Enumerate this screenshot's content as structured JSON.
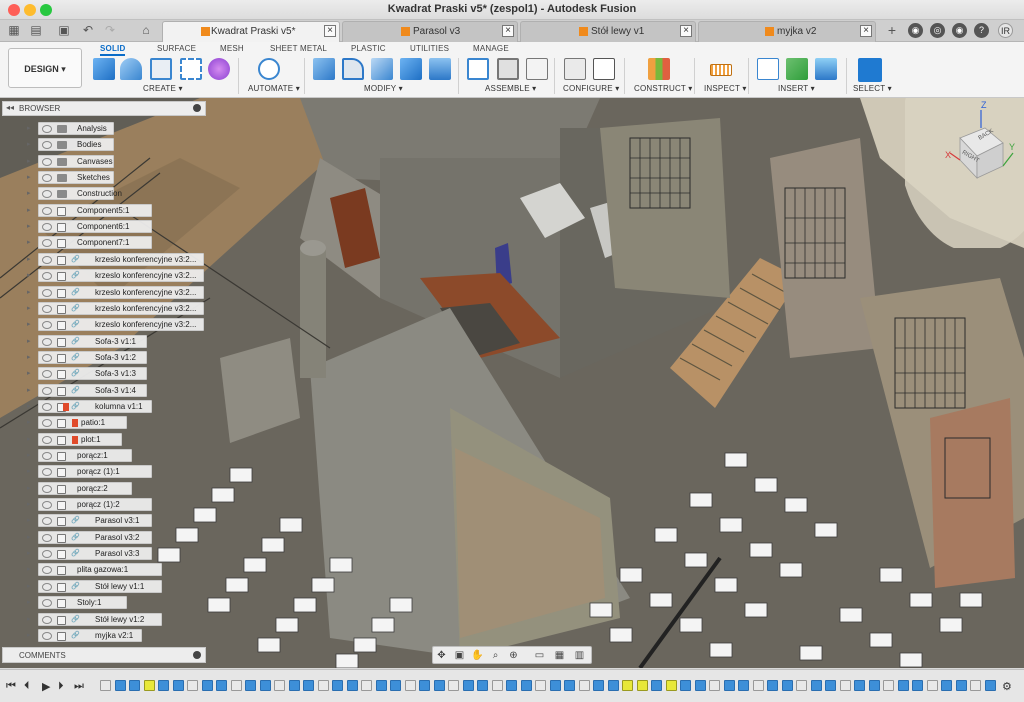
{
  "window": {
    "title": "Kwadrat Praski v5* (zespol1) - Autodesk Fusion"
  },
  "tabs": [
    {
      "label": "Kwadrat Praski v5*",
      "active": true
    },
    {
      "label": "Parasol v3",
      "active": false
    },
    {
      "label": "Stół lewy v1",
      "active": false
    },
    {
      "label": "myjka v2",
      "active": false
    }
  ],
  "user_initials": "IR",
  "toolbar": {
    "workspace_button": "DESIGN ▾",
    "workspace_tabs": [
      "SOLID",
      "SURFACE",
      "MESH",
      "SHEET METAL",
      "PLASTIC",
      "UTILITIES",
      "MANAGE"
    ],
    "active_tab": "SOLID",
    "groups": [
      "CREATE ▾",
      "AUTOMATE ▾",
      "MODIFY ▾",
      "ASSEMBLE ▾",
      "CONFIGURE ▾",
      "CONSTRUCT ▾",
      "INSPECT ▾",
      "INSERT ▾",
      "SELECT ▾"
    ]
  },
  "browser": {
    "header": "BROWSER",
    "items": [
      {
        "label": "Analysis",
        "kind": "folder"
      },
      {
        "label": "Bodies",
        "kind": "folder"
      },
      {
        "label": "Canvases",
        "kind": "folder"
      },
      {
        "label": "Sketches",
        "kind": "folder"
      },
      {
        "label": "Construction",
        "kind": "folder"
      },
      {
        "label": "Component5:1",
        "kind": "comp"
      },
      {
        "label": "Component6:1",
        "kind": "comp"
      },
      {
        "label": "Component7:1",
        "kind": "comp"
      },
      {
        "label": "krzeslo konferencyjne v3:2...",
        "kind": "link"
      },
      {
        "label": "krzeslo konferencyjne v3:2...",
        "kind": "link"
      },
      {
        "label": "krzeslo konferencyjne v3:2...",
        "kind": "link"
      },
      {
        "label": "krzeslo konferencyjne v3:2...",
        "kind": "link"
      },
      {
        "label": "krzeslo konferencyjne v3:2...",
        "kind": "link"
      },
      {
        "label": "Sofa-3 v1:1",
        "kind": "link"
      },
      {
        "label": "Sofa-3 v1:2",
        "kind": "link"
      },
      {
        "label": "Sofa-3 v1:3",
        "kind": "link"
      },
      {
        "label": "Sofa-3 v1:4",
        "kind": "link"
      },
      {
        "label": "kolumna v1:1",
        "kind": "warnlink"
      },
      {
        "label": "patio:1",
        "kind": "warn"
      },
      {
        "label": "plot:1",
        "kind": "warn"
      },
      {
        "label": "porącz:1",
        "kind": "comp"
      },
      {
        "label": "porącz (1):1",
        "kind": "comp"
      },
      {
        "label": "porącz:2",
        "kind": "comp"
      },
      {
        "label": "porącz (1):2",
        "kind": "comp"
      },
      {
        "label": "Parasol v3:1",
        "kind": "link"
      },
      {
        "label": "Parasol v3:2",
        "kind": "link"
      },
      {
        "label": "Parasol v3:3",
        "kind": "link"
      },
      {
        "label": "plita gazowa:1",
        "kind": "comp"
      },
      {
        "label": "Stół lewy v1:1",
        "kind": "link"
      },
      {
        "label": "Stoly:1",
        "kind": "comp"
      },
      {
        "label": "Stół lewy v1:2",
        "kind": "link"
      },
      {
        "label": "myjka v2:1",
        "kind": "link"
      }
    ]
  },
  "comments": {
    "label": "COMMENTS"
  },
  "viewcube": {
    "axis_z": "Z",
    "axis_x": "X",
    "axis_y": "Y",
    "face_back": "BACK",
    "face_right": "RIGHT"
  },
  "colors": {
    "accent": "#0a6cc8",
    "cube_orange": "#f08a1c",
    "timeline_blue": "#3d8fd8",
    "timeline_highlight": "#e8e83a"
  }
}
